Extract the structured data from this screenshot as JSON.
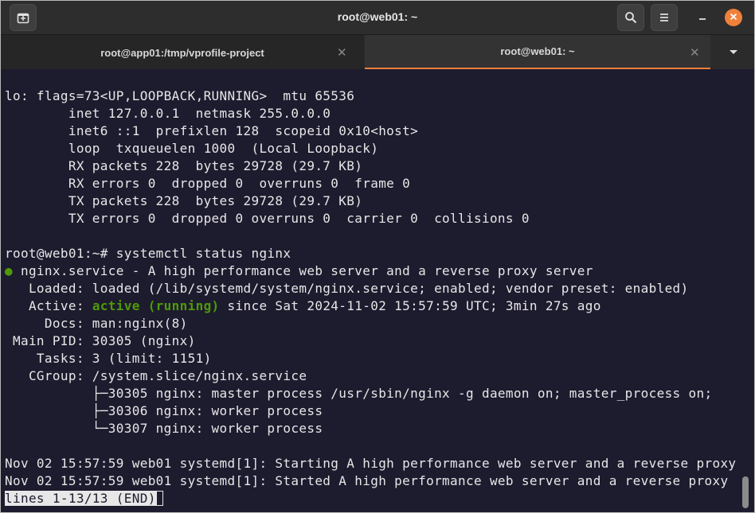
{
  "window": {
    "title": "root@web01: ~"
  },
  "tabs": [
    {
      "label": "root@app01:/tmp/vprofile-project",
      "active": false
    },
    {
      "label": "root@web01: ~",
      "active": true
    }
  ],
  "icons": {
    "new_tab": "new-tab-icon",
    "search": "search-icon",
    "menu": "hamburger-menu-icon",
    "minimize": "minimize-icon",
    "close": "close-icon",
    "tab_close": "close-icon",
    "tab_dropdown": "chevron-down-icon"
  },
  "colors": {
    "terminal_bg": "#1d1b2e",
    "active_tab_accent": "#f0803a",
    "status_green": "#4e9a06"
  },
  "terminal": {
    "lines": [
      "lo: flags=73<UP,LOOPBACK,RUNNING>  mtu 65536",
      "        inet 127.0.0.1  netmask 255.0.0.0",
      "        inet6 ::1  prefixlen 128  scopeid 0x10<host>",
      "        loop  txqueuelen 1000  (Local Loopback)",
      "        RX packets 228  bytes 29728 (29.7 KB)",
      "        RX errors 0  dropped 0  overruns 0  frame 0",
      "        TX packets 228  bytes 29728 (29.7 KB)",
      "        TX errors 0  dropped 0 overruns 0  carrier 0  collisions 0",
      "",
      "root@web01:~# systemctl status nginx"
    ],
    "service_dot": "●",
    "service_line": " nginx.service - A high performance web server and a reverse proxy server",
    "loaded_line": "   Loaded: loaded (/lib/systemd/system/nginx.service; enabled; vendor preset: enabled)",
    "active_label": "   Active: ",
    "active_state": "active (running)",
    "active_rest": " since Sat 2024-11-02 15:57:59 UTC; 3min 27s ago",
    "lines2": [
      "     Docs: man:nginx(8)",
      " Main PID: 30305 (nginx)",
      "    Tasks: 3 (limit: 1151)",
      "   CGroup: /system.slice/nginx.service",
      "           ├─30305 nginx: master process /usr/sbin/nginx -g daemon on; master_process on;",
      "           ├─30306 nginx: worker process",
      "           └─30307 nginx: worker process",
      "",
      "Nov 02 15:57:59 web01 systemd[1]: Starting A high performance web server and a reverse proxy",
      "Nov 02 15:57:59 web01 systemd[1]: Started A high performance web server and a reverse proxy"
    ],
    "pager_status": "lines 1-13/13 (END)"
  }
}
